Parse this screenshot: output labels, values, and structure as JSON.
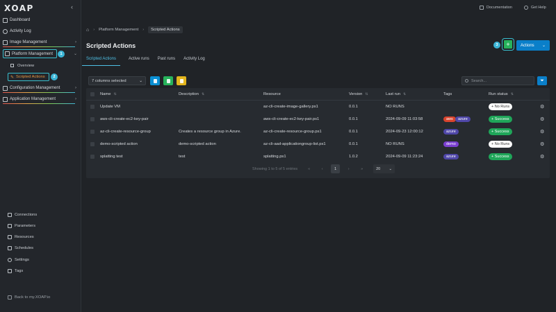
{
  "app": {
    "logo": "XOAP",
    "collapse_icon": "chevron-left-icon"
  },
  "colors": {
    "accent": "#0a7fc9",
    "success": "#1fa659",
    "tag_aws": "#d8432d",
    "tag_azure": "#4f47a8",
    "tag_demo": "#7a3fd0",
    "highlight": "#39c0cf"
  },
  "sidebar": {
    "items": [
      {
        "label": "Dashboard",
        "icon": "dashboard-icon"
      },
      {
        "label": "Activity Log",
        "icon": "clock-icon"
      },
      {
        "label": "Image Management",
        "icon": "image-icon"
      },
      {
        "label": "Platform Management",
        "icon": "platform-icon"
      },
      {
        "label": "Configuration Management",
        "icon": "config-icon"
      },
      {
        "label": "Application Management",
        "icon": "app-icon"
      }
    ],
    "sub_items": [
      {
        "label": "Overview"
      },
      {
        "label": "Scripted Actions"
      }
    ],
    "steps": [
      "1",
      "2",
      "3"
    ],
    "bottom": [
      {
        "label": "Connections",
        "icon": "link-icon"
      },
      {
        "label": "Parameters",
        "icon": "sliders-icon"
      },
      {
        "label": "Resources",
        "icon": "resources-icon"
      },
      {
        "label": "Schedules",
        "icon": "calendar-icon"
      },
      {
        "label": "Settings",
        "icon": "gear-icon"
      },
      {
        "label": "Tags",
        "icon": "tag-icon"
      }
    ],
    "back_link": "Back to my.XOAP.io"
  },
  "top_links": {
    "documentation": "Documentation",
    "help": "Get Help"
  },
  "breadcrumb": {
    "home_icon": "home-icon",
    "parent": "Platform Management",
    "current": "Scripted Actions"
  },
  "page": {
    "title": "Scripted Actions",
    "add_label": "+",
    "actions_label": "Actions"
  },
  "tabs": [
    "Scripted Actions",
    "Active runs",
    "Past runs",
    "Activity Log"
  ],
  "toolbar": {
    "columns_selected": "7 columns selected",
    "search_placeholder": "Search...",
    "filter_icon": "filter-icon"
  },
  "table": {
    "headers": [
      "Name",
      "Description",
      "Resource",
      "Version",
      "Last run",
      "Tags",
      "Run status"
    ],
    "rows": [
      {
        "name": "Update VM",
        "description": "",
        "resource": "az-cli-create-image-gallery.ps1",
        "version": "0.0.1",
        "last_run": "NO RUNS",
        "tags": [],
        "status": "No Runs",
        "status_type": "norun"
      },
      {
        "name": "aws-cli-create-ec2-key-pair",
        "description": "",
        "resource": "aws-cli-create-ec2-key-pair.ps1",
        "version": "0.0.1",
        "last_run": "2024-09-09 11:03:58",
        "tags": [
          "aws",
          "azure"
        ],
        "status": "Success",
        "status_type": "success"
      },
      {
        "name": "az-cli-create-resource-group",
        "description": "Creates a resource group in Azure.",
        "resource": "az-cli-create-resource-group.ps1",
        "version": "0.0.1",
        "last_run": "2024-09-23 12:00:12",
        "tags": [
          "azure"
        ],
        "status": "Success",
        "status_type": "success"
      },
      {
        "name": "demo-scripted action",
        "description": "demo-scripted action",
        "resource": "az-cli-aad-applicationgroup-list.ps1",
        "version": "0.0.1",
        "last_run": "NO RUNS",
        "tags": [
          "demo"
        ],
        "status": "No Runs",
        "status_type": "norun"
      },
      {
        "name": "splatting test",
        "description": "test",
        "resource": "splatting.ps1",
        "version": "1.0.2",
        "last_run": "2024-09-09 11:23:24",
        "tags": [
          "azure"
        ],
        "status": "Success",
        "status_type": "success"
      }
    ]
  },
  "pagination": {
    "summary": "Showing 1 to 5 of 5 entries",
    "current_page": "1",
    "page_size": "20"
  }
}
